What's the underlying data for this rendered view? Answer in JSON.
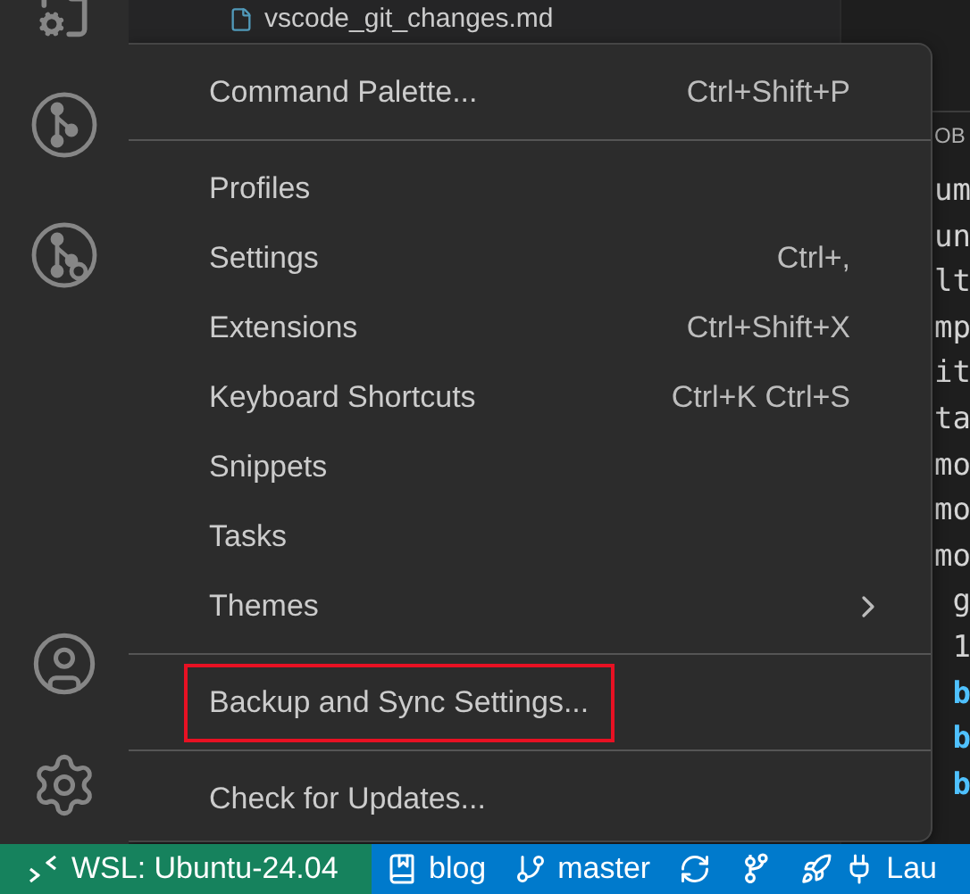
{
  "explorer": {
    "files": [
      "vscode_git_changes.md"
    ]
  },
  "menu": {
    "groups": [
      [
        {
          "label": "Command Palette...",
          "shortcut": "Ctrl+Shift+P"
        }
      ],
      [
        {
          "label": "Profiles"
        },
        {
          "label": "Settings",
          "shortcut": "Ctrl+,"
        },
        {
          "label": "Extensions",
          "shortcut": "Ctrl+Shift+X"
        },
        {
          "label": "Keyboard Shortcuts",
          "shortcut": "Ctrl+K Ctrl+S"
        },
        {
          "label": "Snippets"
        },
        {
          "label": "Tasks"
        },
        {
          "label": "Themes",
          "submenu": true
        }
      ],
      [
        {
          "label": "Backup and Sync Settings...",
          "outlined": true
        }
      ],
      [
        {
          "label": "Check for Updates..."
        }
      ]
    ]
  },
  "editor": {
    "panel_header": "OB",
    "lines": [
      {
        "text": "um",
        "kind": "plain"
      },
      {
        "text": "un",
        "kind": "plain"
      },
      {
        "text": "lt",
        "kind": "plain"
      },
      {
        "text": "mp",
        "kind": "plain"
      },
      {
        "text": "it",
        "kind": "plain"
      },
      {
        "text": "ta",
        "kind": "plain"
      },
      {
        "text": "mo",
        "kind": "plain"
      },
      {
        "text": "mo",
        "kind": "plain"
      },
      {
        "text": "mo",
        "kind": "plain"
      },
      {
        "text": " g",
        "kind": "plain"
      },
      {
        "text": " 1",
        "kind": "plain"
      },
      {
        "text": " b",
        "kind": "keyword"
      },
      {
        "text": " b",
        "kind": "keyword"
      },
      {
        "text": " b",
        "kind": "keyword"
      }
    ]
  },
  "status_bar": {
    "remote": "WSL: Ubuntu-24.04",
    "items": [
      {
        "kind": "repo",
        "label": "blog"
      },
      {
        "kind": "branch",
        "label": "master"
      },
      {
        "kind": "sync"
      },
      {
        "kind": "graph"
      },
      {
        "kind": "deploy",
        "label": "Lau"
      }
    ]
  }
}
